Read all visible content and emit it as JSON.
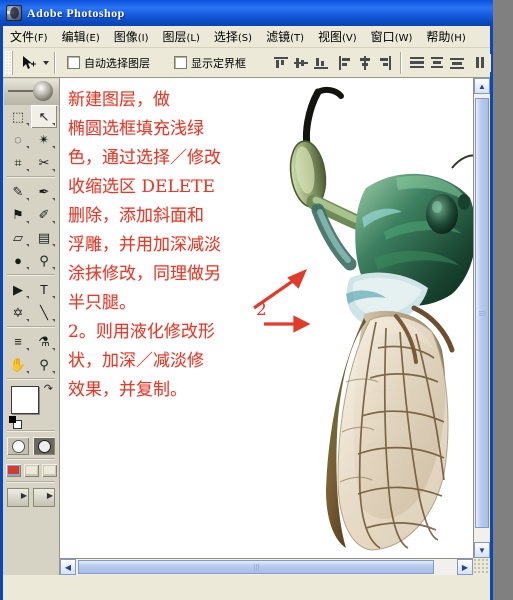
{
  "window": {
    "title": "Adobe Photoshop",
    "icon": "photoshop-icon"
  },
  "menubar": {
    "items": [
      {
        "label": "文件",
        "mnemonic": "(F)"
      },
      {
        "label": "编辑",
        "mnemonic": "(E)"
      },
      {
        "label": "图像",
        "mnemonic": "(I)"
      },
      {
        "label": "图层",
        "mnemonic": "(L)"
      },
      {
        "label": "选择",
        "mnemonic": "(S)"
      },
      {
        "label": "滤镜",
        "mnemonic": "(T)"
      },
      {
        "label": "视图",
        "mnemonic": "(V)"
      },
      {
        "label": "窗口",
        "mnemonic": "(W)"
      },
      {
        "label": "帮助",
        "mnemonic": "(H)"
      }
    ]
  },
  "options_bar": {
    "active_tool_icon": "move-tool-icon",
    "tool_preset_dropdown": "chevron-down-icon",
    "checkboxes": [
      {
        "label": "自动选择图层",
        "checked": false
      },
      {
        "label": "显示定界框",
        "checked": false
      }
    ],
    "align_buttons": [
      "align-top-edges",
      "align-vertical-centers",
      "align-bottom-edges",
      "align-left-edges",
      "align-horizontal-centers",
      "align-right-edges",
      "distribute-top-edges",
      "distribute-vertical-centers",
      "distribute-bottom-edges",
      "distribute-left-edges"
    ]
  },
  "toolbox": {
    "tools": [
      {
        "name": "marquee-tool",
        "glyph": "⬚",
        "selected": false
      },
      {
        "name": "move-tool",
        "glyph": "↖",
        "selected": true
      },
      {
        "name": "lasso-tool",
        "glyph": "◌",
        "selected": false
      },
      {
        "name": "magic-wand-tool",
        "glyph": "✴",
        "selected": false
      },
      {
        "name": "crop-tool",
        "glyph": "⌗",
        "selected": false
      },
      {
        "name": "slice-tool",
        "glyph": "✂",
        "selected": false
      },
      {
        "name": "healing-brush-tool",
        "glyph": "✎",
        "selected": false
      },
      {
        "name": "brush-tool",
        "glyph": "✒",
        "selected": false
      },
      {
        "name": "clone-stamp-tool",
        "glyph": "⚑",
        "selected": false
      },
      {
        "name": "history-brush-tool",
        "glyph": "✐",
        "selected": false
      },
      {
        "name": "eraser-tool",
        "glyph": "▱",
        "selected": false
      },
      {
        "name": "gradient-tool",
        "glyph": "▤",
        "selected": false
      },
      {
        "name": "blur-tool",
        "glyph": "●",
        "selected": false
      },
      {
        "name": "dodge-tool",
        "glyph": "⚲",
        "selected": false
      },
      {
        "name": "path-selection-tool",
        "glyph": "▶",
        "selected": false
      },
      {
        "name": "type-tool",
        "glyph": "T",
        "selected": false
      },
      {
        "name": "pen-tool",
        "glyph": "✡",
        "selected": false
      },
      {
        "name": "line-tool",
        "glyph": "╲",
        "selected": false
      },
      {
        "name": "notes-tool",
        "glyph": "≡",
        "selected": false
      },
      {
        "name": "eyedropper-tool",
        "glyph": "⚗",
        "selected": false
      },
      {
        "name": "hand-tool",
        "glyph": "✋",
        "selected": false
      },
      {
        "name": "zoom-tool",
        "glyph": "⚲",
        "selected": false
      }
    ],
    "colors": {
      "foreground": "#ffffff",
      "background": "#ee1111"
    },
    "mask_modes": [
      "standard-mask-mode",
      "quick-mask-mode"
    ],
    "screen_modes": [
      "standard-screen-mode",
      "full-screen-with-menubar",
      "full-screen-mode"
    ],
    "jump_to": [
      "jump-to-imageready",
      "jump-to-application"
    ]
  },
  "canvas": {
    "annotation_lines": [
      "新建图层，做",
      "椭圆选框填充浅绿",
      "色，通过选择／修改",
      "收缩选区 DELETE",
      "删除，添加斜面和",
      "浮雕，并用加深减淡",
      "涂抹修改，同理做另",
      "半只腿。",
      "2。则用液化修改形",
      "状，加深／减淡修",
      "效果，并复制。"
    ],
    "annotation_color": "#e23b2b",
    "arrow_label": "2",
    "artwork": "cicada-illustration"
  },
  "scrollbars": {
    "vertical": {
      "up": "scroll-up-icon",
      "down": "scroll-down-icon"
    },
    "horizontal": {
      "left": "scroll-left-icon",
      "right": "scroll-right-icon"
    }
  }
}
